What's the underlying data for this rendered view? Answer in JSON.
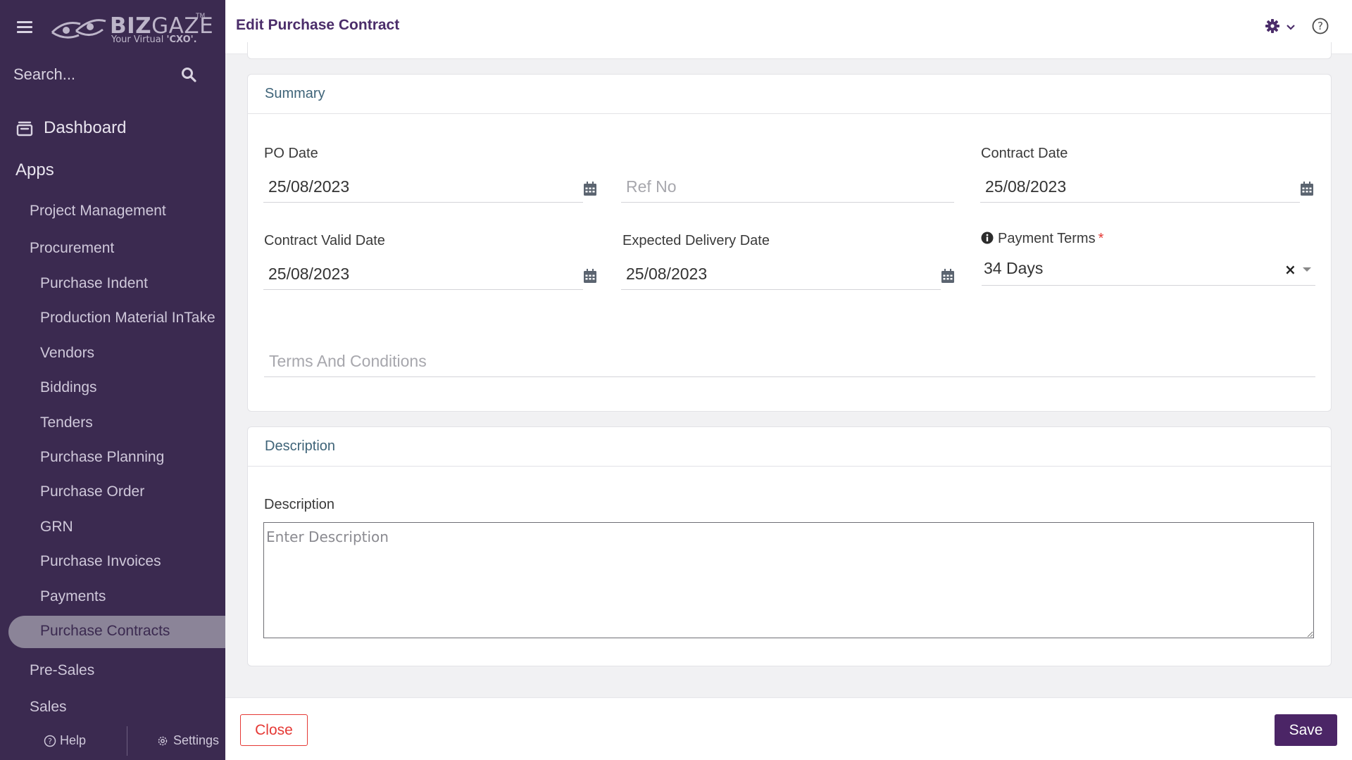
{
  "sidebar": {
    "logo": {
      "brand": "BIZGAZE",
      "brand_bold": "BIZ",
      "brand_light": "GAZE",
      "trademark": "TM",
      "tagline_prefix": "Your Virtual ",
      "tagline_bold": "'CXO'."
    },
    "search_placeholder": "Search...",
    "dashboard_label": "Dashboard",
    "apps_label": "Apps",
    "items": [
      {
        "label": "Project Management",
        "level": 1
      },
      {
        "label": "Procurement",
        "level": 1
      },
      {
        "label": "Purchase Indent",
        "level": 2
      },
      {
        "label": "Production Material InTake",
        "level": 2
      },
      {
        "label": "Vendors",
        "level": 2
      },
      {
        "label": "Biddings",
        "level": 2
      },
      {
        "label": "Tenders",
        "level": 2
      },
      {
        "label": "Purchase Planning",
        "level": 2
      },
      {
        "label": "Purchase Order",
        "level": 2
      },
      {
        "label": "GRN",
        "level": 2
      },
      {
        "label": "Purchase Invoices",
        "level": 2
      },
      {
        "label": "Payments",
        "level": 2
      },
      {
        "label": "Purchase Contracts",
        "level": 2,
        "active": true
      },
      {
        "label": "Pre-Sales",
        "level": 1
      },
      {
        "label": "Sales",
        "level": 1
      }
    ],
    "footer": {
      "help_label": "Help",
      "settings_label": "Settings"
    }
  },
  "header": {
    "title": "Edit Purchase Contract"
  },
  "summary": {
    "title": "Summary",
    "po_date": {
      "label": "PO Date",
      "value": "25/08/2023"
    },
    "ref_no": {
      "placeholder": "Ref No",
      "value": ""
    },
    "contract_date": {
      "label": "Contract Date",
      "value": "25/08/2023"
    },
    "contract_valid_date": {
      "label": "Contract Valid Date",
      "value": "25/08/2023"
    },
    "expected_delivery_date": {
      "label": "Expected Delivery Date",
      "value": "25/08/2023"
    },
    "payment_terms": {
      "label": "Payment Terms",
      "required_mark": "*",
      "value": "34 Days"
    },
    "terms_and_conditions": {
      "placeholder": "Terms And Conditions",
      "value": ""
    }
  },
  "description": {
    "title": "Description",
    "label": "Description",
    "placeholder": "Enter Description",
    "value": ""
  },
  "footer": {
    "close_label": "Close",
    "save_label": "Save"
  },
  "colors": {
    "sidebar_bg": "#3b2a50",
    "brand_purple": "#4b2566",
    "title_purple": "#4b2d6a",
    "close_red": "#e53935",
    "section_title": "#3e6378"
  }
}
